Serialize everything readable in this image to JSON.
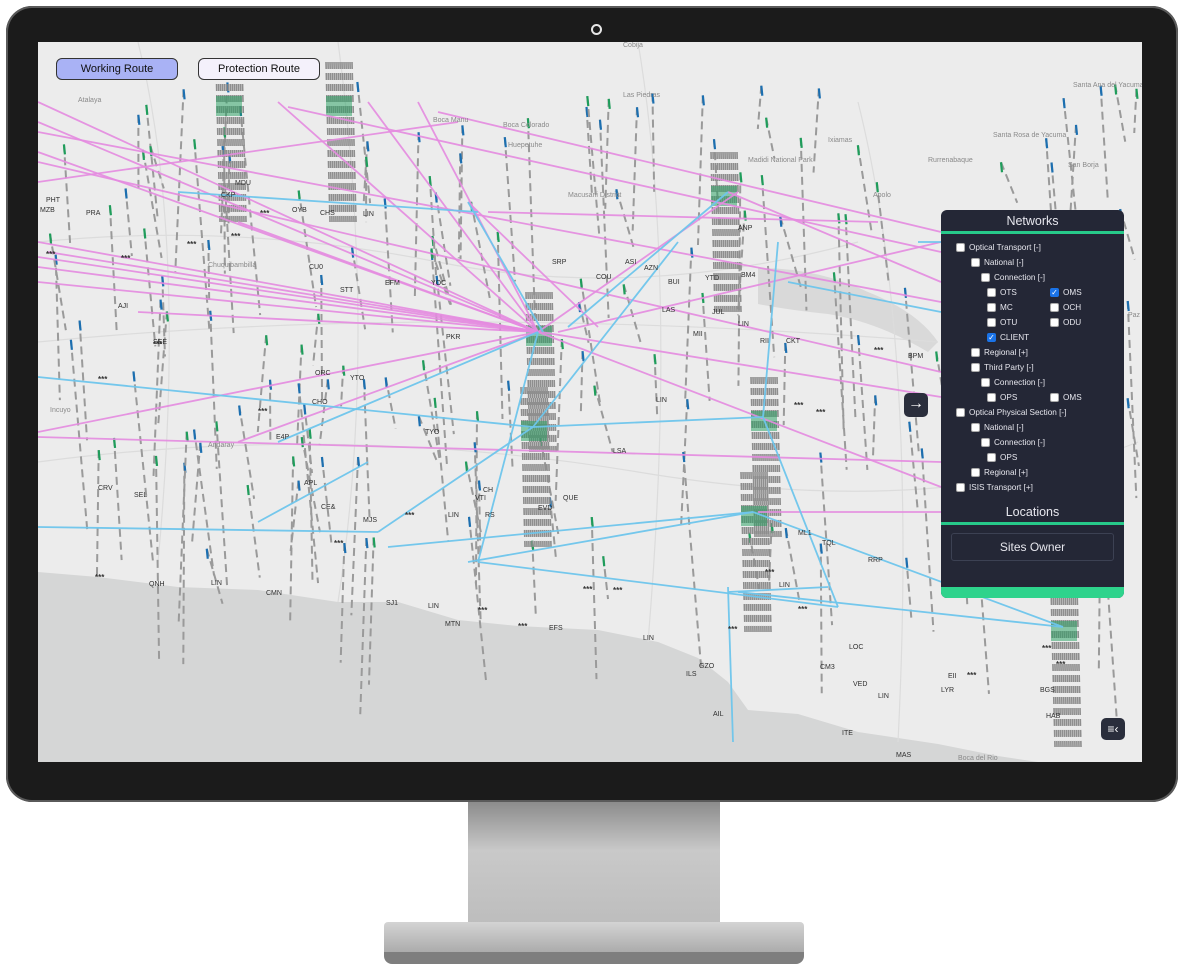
{
  "route_buttons": {
    "working": "Working Route",
    "protection": "Protection Route"
  },
  "map": {
    "places": [
      "Atalaya",
      "Cobija",
      "Las Piedras",
      "Boca Manu",
      "Boca Colorado",
      "Huepetuhe",
      "Macusani District",
      "Madidi National Park",
      "Ixiamas",
      "Apolo",
      "Rurrenabaque",
      "Santa Rosa de Yacuma",
      "San Borja",
      "Santa Ana del Yacuma",
      "Chuquibambilla",
      "Andaray",
      "Incuyo",
      "Boca del Rio",
      "Paz"
    ],
    "site_labels": [
      "PHT",
      "MZB",
      "PRA",
      "CKP",
      "MDU",
      "OYB",
      "CHS",
      "LIN",
      "SRP",
      "COU",
      "ASI",
      "AZN",
      "ANP",
      "BM4",
      "BUI",
      "LAS",
      "YTD",
      "JUL",
      "MII",
      "RII",
      "CKT",
      "LIN",
      "BPM",
      "CU0",
      "STT",
      "EFM",
      "YOC",
      "PKR",
      "SEE",
      "AJI",
      "ORC",
      "CHO",
      "YTO",
      "TYO",
      "LSA",
      "LIN",
      "QUE",
      "E4P",
      "APL",
      "CE&",
      "MJS",
      "VTI",
      "CH",
      "EVD",
      "LIN",
      "RS",
      "SJ1",
      "MTN",
      "LIN",
      "EFS",
      "CRV",
      "SEL",
      "QNH",
      "LIN",
      "CMN",
      "LIN",
      "GZO",
      "ILS",
      "AIL",
      "CM3",
      "LOC",
      "VED",
      "LIN",
      "ITE",
      "MAS",
      "LYR",
      "BGS",
      "HAB",
      "TQL",
      "ML1",
      "LIN",
      "RRP",
      "EII"
    ],
    "masked_labels": [
      "***",
      "***",
      "***",
      "***",
      "***",
      "***",
      "***",
      "***",
      "***",
      "***",
      "***",
      "***",
      "***",
      "***",
      "***",
      "***",
      "***",
      "***",
      "***",
      "***",
      "***",
      "***",
      "***",
      "***"
    ]
  },
  "panel": {
    "networks_title": "Networks",
    "optical_transport": "Optical Transport [-]",
    "national": "National [-]",
    "connection": "Connection [-]",
    "ots": "OTS",
    "oms": "OMS",
    "mc": "MC",
    "och": "OCH",
    "otu": "OTU",
    "odu": "ODU",
    "client": "CLIENT",
    "regional": "Regional [+]",
    "third_party": "Third Party [-]",
    "tp_connection": "Connection [-]",
    "tp_ops": "OPS",
    "tp_oms": "OMS",
    "ops_section": "Optical Physical Section [-]",
    "ops_national": "National [-]",
    "ops_connection": "Connection [-]",
    "ops_ops": "OPS",
    "ops_regional": "Regional [+]",
    "isis": "ISIS Transport [+]",
    "locations_title": "Locations",
    "sites_owner": "Sites Owner",
    "checked": {
      "oms": true,
      "client": true
    }
  },
  "icons": {
    "expand": "arrow-right-icon",
    "menu": "menu-collapse-icon"
  },
  "colors": {
    "working_route": "#e58be0",
    "protection_route": "#6ec6ec",
    "accent": "#27c98a",
    "panel_bg": "#242736"
  }
}
